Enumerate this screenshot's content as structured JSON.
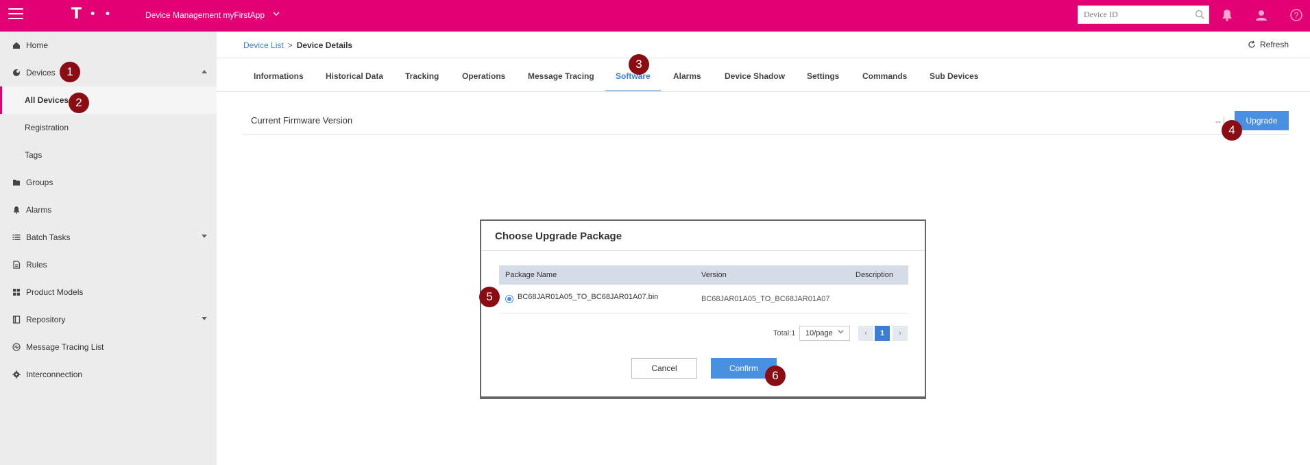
{
  "topbar": {
    "logo_letter": "T",
    "logo_dots": "• •",
    "app_title": "Device Management myFirstApp",
    "search_placeholder": "Device ID"
  },
  "sidebar": {
    "items": [
      {
        "label": "Home",
        "icon": "home-icon"
      },
      {
        "label": "Devices",
        "icon": "devices-icon"
      },
      {
        "label": "All Devices"
      },
      {
        "label": "Registration"
      },
      {
        "label": "Tags"
      },
      {
        "label": "Groups",
        "icon": "folder-icon"
      },
      {
        "label": "Alarms",
        "icon": "bell-icon"
      },
      {
        "label": "Batch Tasks",
        "icon": "list-icon"
      },
      {
        "label": "Rules",
        "icon": "document-icon"
      },
      {
        "label": "Product Models",
        "icon": "grid-icon"
      },
      {
        "label": "Repository",
        "icon": "book-icon"
      },
      {
        "label": "Message Tracing List",
        "icon": "tracing-icon"
      },
      {
        "label": "Interconnection",
        "icon": "gear-icon"
      }
    ]
  },
  "breadcrumb": {
    "parent": "Device List",
    "separator": ">",
    "current": "Device Details"
  },
  "refresh_label": "Refresh",
  "tabs": [
    "Informations",
    "Historical Data",
    "Tracking",
    "Operations",
    "Message Tracing",
    "Software",
    "Alarms",
    "Device Shadow",
    "Settings",
    "Commands",
    "Sub Devices"
  ],
  "active_tab": "Software",
  "firmware": {
    "label": "Current Firmware Version",
    "value": "--",
    "upgrade_label": "Upgrade"
  },
  "modal": {
    "title": "Choose Upgrade Package",
    "columns": [
      "Package Name",
      "Version",
      "Description"
    ],
    "rows": [
      {
        "package": "BC68JAR01A05_TO_BC68JAR01A07.bin",
        "version": "BC68JAR01A05_TO_BC68JAR01A07",
        "description": ""
      }
    ],
    "total": "Total:1",
    "page_size": "10/page",
    "current_page": "1",
    "prev": "‹",
    "next": "›",
    "cancel_label": "Cancel",
    "confirm_label": "Confirm"
  },
  "markers": [
    "1",
    "2",
    "3",
    "4",
    "5",
    "6"
  ],
  "colors": {
    "brand": "#e20074",
    "accent": "#4a90e2",
    "marker": "#8b0d14"
  }
}
